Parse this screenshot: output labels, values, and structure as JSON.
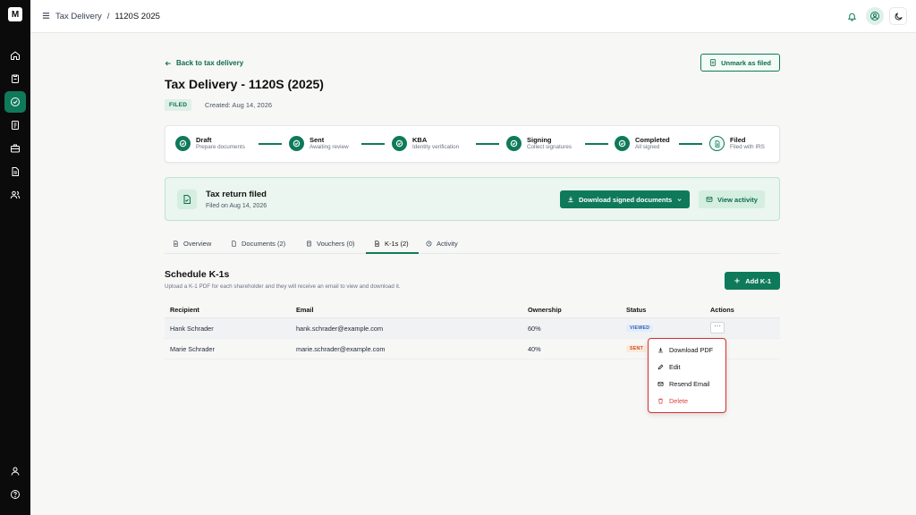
{
  "sidebar": {
    "logo": "M",
    "items": [
      {
        "icon": "home-icon"
      },
      {
        "icon": "clipboard-icon"
      },
      {
        "icon": "check-circle-icon",
        "active": true
      },
      {
        "icon": "document-icon"
      },
      {
        "icon": "briefcase-icon"
      },
      {
        "icon": "file-text-icon"
      },
      {
        "icon": "users-icon"
      }
    ],
    "bottom": [
      {
        "icon": "user-icon"
      },
      {
        "icon": "help-icon"
      }
    ]
  },
  "topbar": {
    "breadcrumb_parent": "Tax Delivery",
    "separator": "/",
    "breadcrumb_current": "1120S 2025"
  },
  "page": {
    "back_label": "Back to tax delivery",
    "unmark_label": "Unmark as filed",
    "title": "Tax Delivery - 1120S (2025)",
    "status_badge": "FILED",
    "created": "Created: Aug 14, 2026"
  },
  "steps": [
    {
      "label": "Draft",
      "sub": "Prepare documents"
    },
    {
      "label": "Sent",
      "sub": "Awaiting review"
    },
    {
      "label": "KBA",
      "sub": "Identity verification"
    },
    {
      "label": "Signing",
      "sub": "Collect signatures"
    },
    {
      "label": "Completed",
      "sub": "All signed"
    },
    {
      "label": "Filed",
      "sub": "Filed with IRS"
    }
  ],
  "filed_card": {
    "title": "Tax return filed",
    "subtitle": "Filed on Aug 14, 2026",
    "download_label": "Download signed documents",
    "view_activity_label": "View activity"
  },
  "tabs": [
    {
      "label": "Overview"
    },
    {
      "label": "Documents (2)"
    },
    {
      "label": "Vouchers (0)"
    },
    {
      "label": "K-1s (2)",
      "active": true
    },
    {
      "label": "Activity"
    }
  ],
  "k1": {
    "title": "Schedule K-1s",
    "subtitle": "Upload a K-1 PDF for each shareholder and they will receive an email to view and download it.",
    "add_label": "Add K-1",
    "columns": [
      "Recipient",
      "Email",
      "Ownership",
      "Status",
      "Actions"
    ],
    "rows": [
      {
        "recipient": "Hank Schrader",
        "email": "hank.schrader@example.com",
        "ownership": "60%",
        "status": "VIEWED"
      },
      {
        "recipient": "Marie Schrader",
        "email": "marie.schrader@example.com",
        "ownership": "40%",
        "status": "SENT"
      }
    ],
    "more_label": "···"
  },
  "menu": {
    "items": [
      {
        "label": "Download PDF",
        "icon": "download-icon"
      },
      {
        "label": "Edit",
        "icon": "pencil-icon"
      },
      {
        "label": "Resend Email",
        "icon": "mail-icon"
      },
      {
        "label": "Delete",
        "icon": "trash-icon",
        "danger": true
      }
    ]
  },
  "colors": {
    "accent": "#0f7a5a",
    "danger": "#d64545",
    "sidebar": "#0b0b0b"
  }
}
